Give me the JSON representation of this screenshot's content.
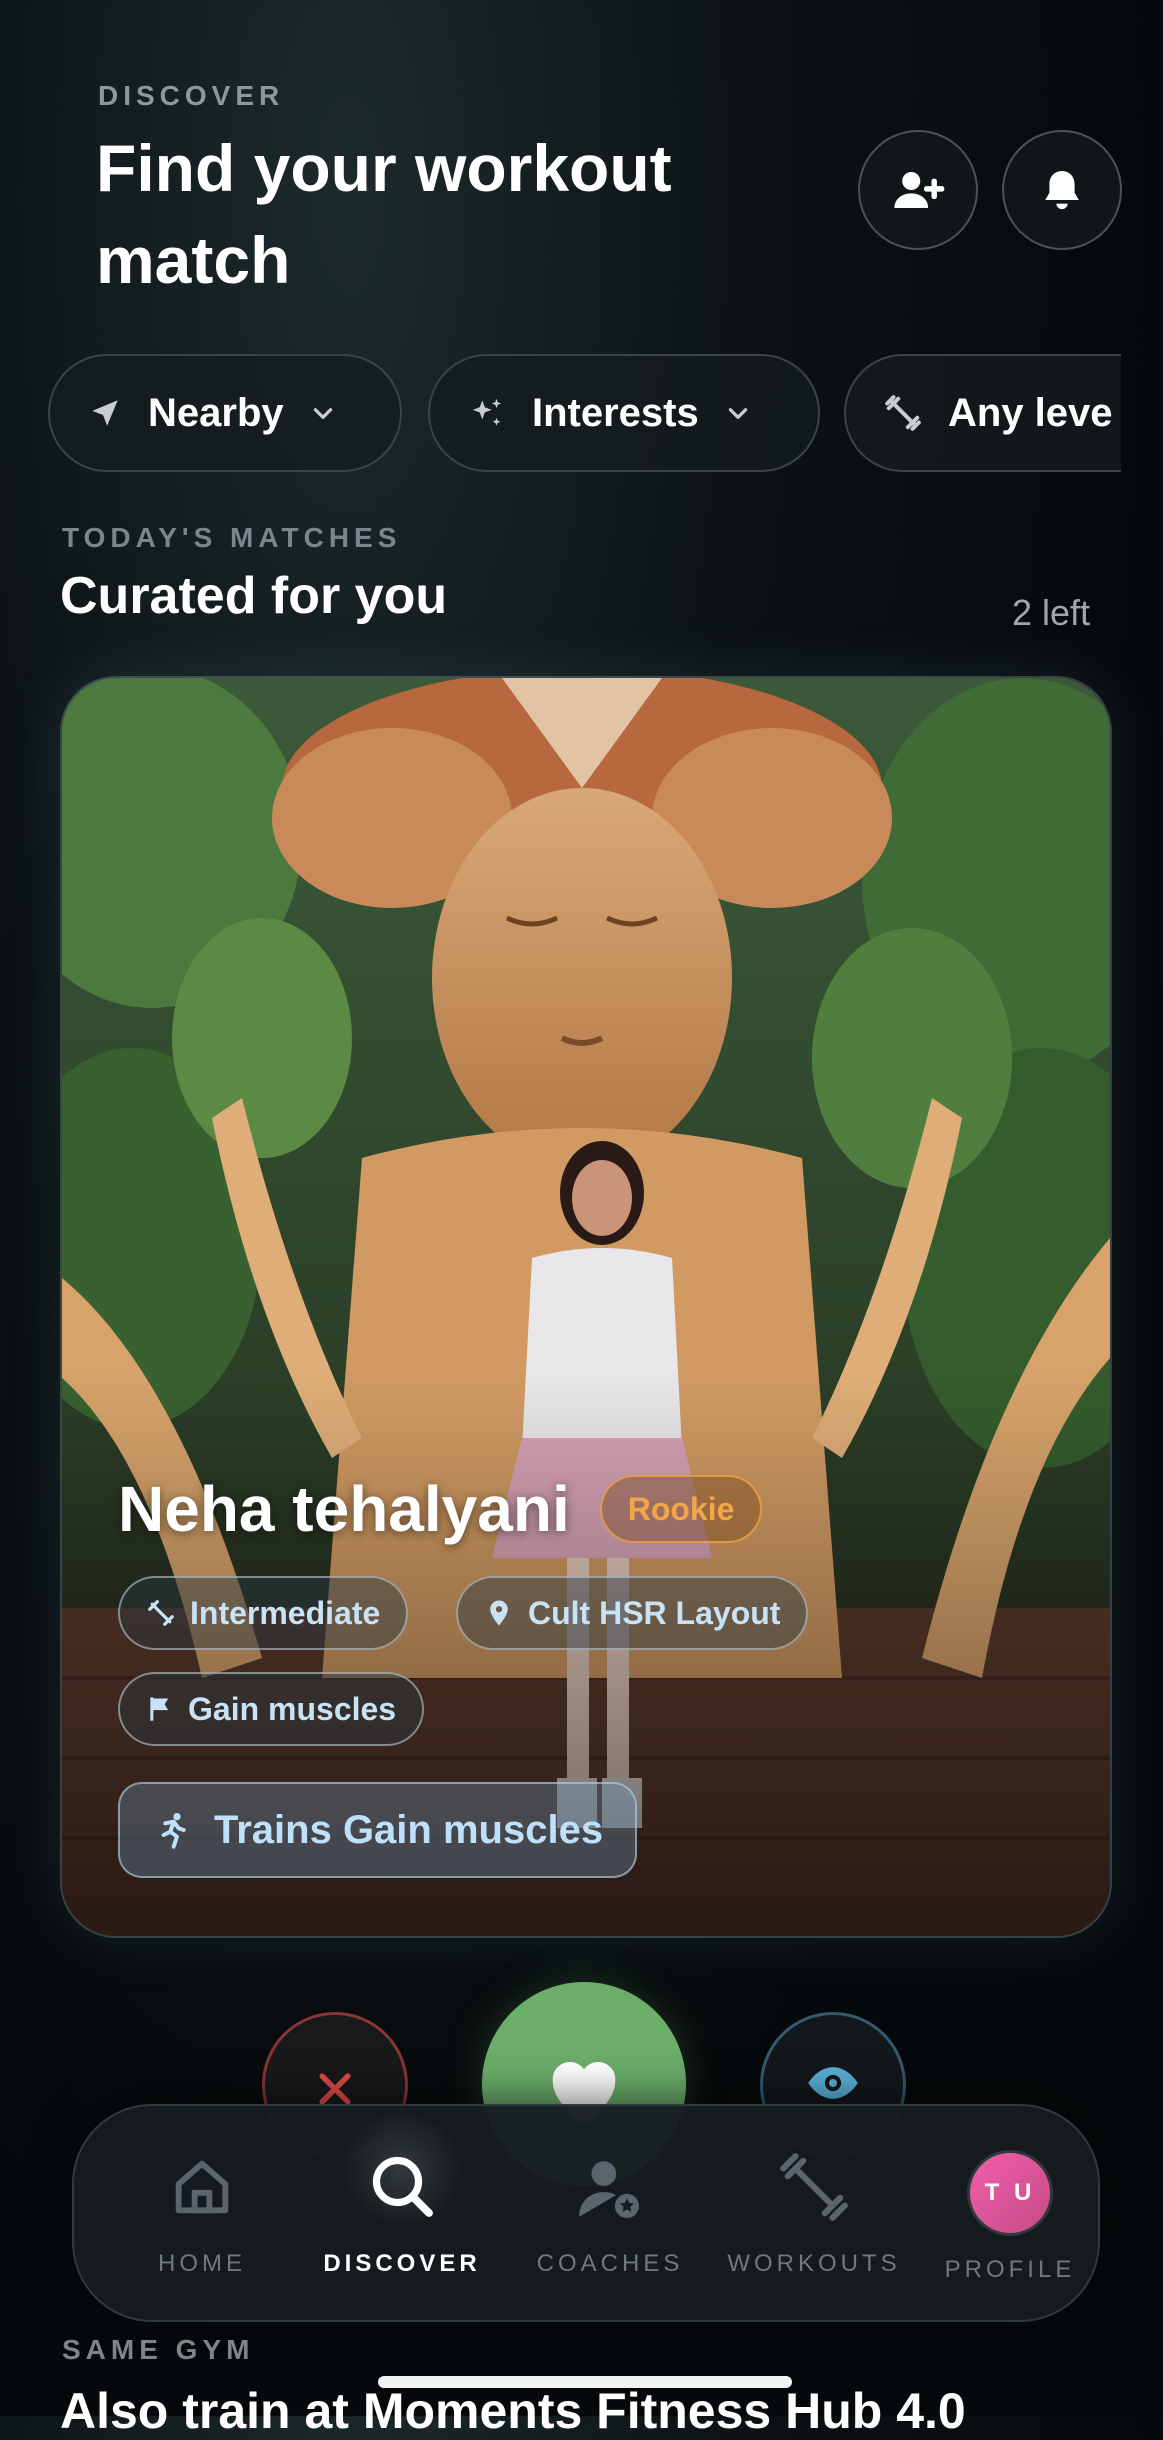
{
  "header": {
    "eyebrow": "DISCOVER",
    "title_line1": "Find your workout",
    "title_line2": "match",
    "add_friend_icon": "person-plus-icon",
    "notifications_icon": "bell-icon"
  },
  "filters": [
    {
      "label": "Nearby",
      "icon": "location-arrow-icon"
    },
    {
      "label": "Interests",
      "icon": "sparkles-icon"
    },
    {
      "label": "Any leve",
      "icon": "dumbbell-icon"
    }
  ],
  "matches": {
    "eyebrow": "TODAY'S MATCHES",
    "title": "Curated for you",
    "count_text": "2 left"
  },
  "profile_card": {
    "name": "Neha tehalyani",
    "badge": "Rookie",
    "tags": [
      {
        "label": "Intermediate",
        "icon": "dumbbell-icon"
      },
      {
        "label": "Cult HSR Layout",
        "icon": "location-pin-icon"
      },
      {
        "label": "Gain muscles",
        "icon": "flag-icon"
      }
    ],
    "trains_label": "Trains Gain muscles",
    "trains_icon": "running-figure-icon"
  },
  "actions": {
    "pass_icon": "close-icon",
    "like_icon": "heart-icon",
    "view_icon": "eye-icon"
  },
  "nav": {
    "items": [
      {
        "label": "HOME",
        "icon": "home-icon",
        "active": false
      },
      {
        "label": "DISCOVER",
        "icon": "search-icon",
        "active": true
      },
      {
        "label": "COACHES",
        "icon": "coach-icon",
        "active": false
      },
      {
        "label": "WORKOUTS",
        "icon": "dumbbell-icon",
        "active": false
      },
      {
        "label": "PROFILE",
        "icon": "avatar",
        "active": false
      }
    ],
    "avatar_initials": "T U"
  },
  "same_gym": {
    "eyebrow": "SAME GYM",
    "title": "Also train at Moments Fitness Hub 4.0"
  },
  "colors": {
    "accent_green": "#6aae6a",
    "badge_orange": "#f3a54a",
    "tag_text": "#c9e3f6",
    "pass_red": "#e34a4a",
    "view_blue": "#5bb0d8"
  }
}
